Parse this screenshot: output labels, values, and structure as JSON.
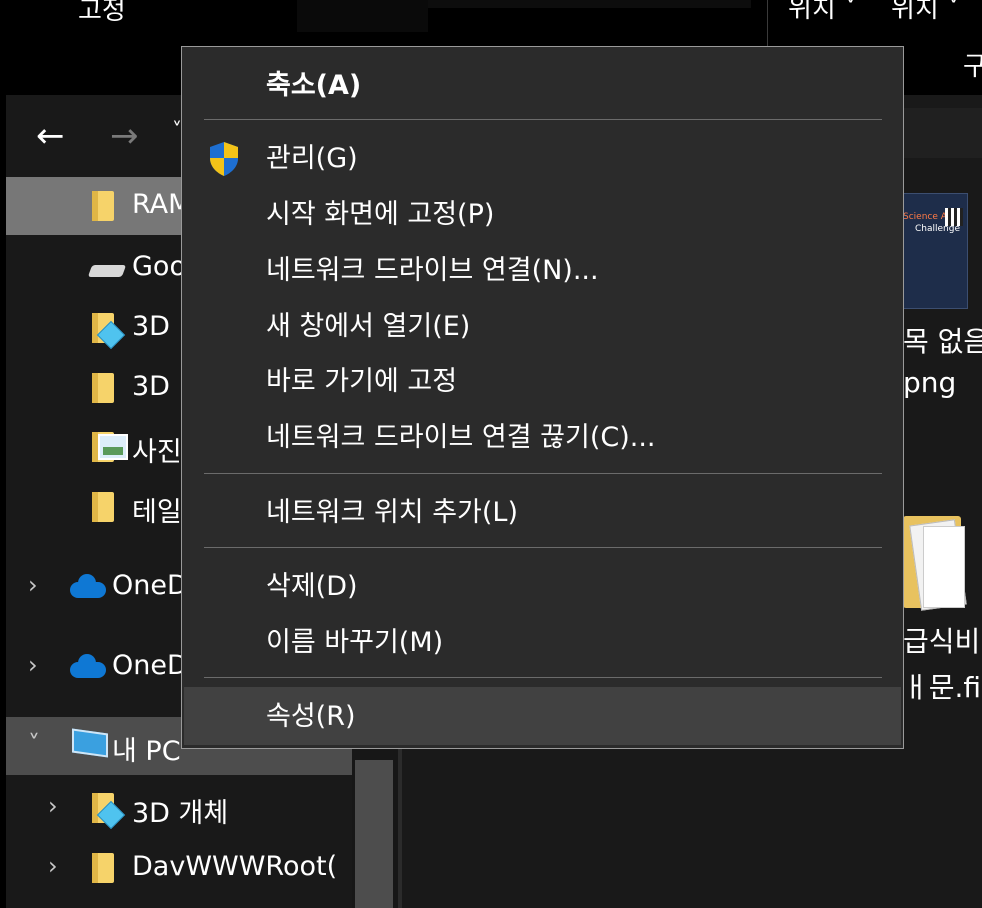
{
  "ribbon": {
    "pin_label": "고정",
    "location_1": "위치 ˅",
    "location_2": "위치 ˅",
    "group_label": "구"
  },
  "navbar": {
    "back": "←",
    "forward": "→",
    "dropdown": "˅"
  },
  "navpane": {
    "items": [
      {
        "label": "RAM",
        "icon": "folder-icon"
      },
      {
        "label": "Goo",
        "icon": "drive-icon"
      },
      {
        "label": "3D",
        "icon": "folder-3d-icon"
      },
      {
        "label": "3D",
        "icon": "folder-icon"
      },
      {
        "label": "사진",
        "icon": "pictures-icon"
      },
      {
        "label": "테일",
        "icon": "folder-icon"
      },
      {
        "label": "OneD",
        "icon": "onedrive-icon"
      },
      {
        "label": "OneD",
        "icon": "onedrive-icon"
      },
      {
        "label": "내 PC",
        "icon": "pc-icon"
      },
      {
        "label": "3D 개체",
        "icon": "folder-3d-icon"
      },
      {
        "label": "DavWWWRoot(",
        "icon": "folder-icon"
      }
    ],
    "chevron_right": "›",
    "chevron_down": "˅"
  },
  "content": {
    "file1_line1": "목 없음",
    "file1_line2": "png",
    "file2_line1": "급식비",
    "file2_line2": "ㅐ문.file",
    "thumb_text_1": "Science App",
    "thumb_text_2": "Challenge"
  },
  "menu": {
    "collapse": "축소(A)",
    "manage": "관리(G)",
    "pin_start": "시작 화면에 고정(P)",
    "map_drive": "네트워크 드라이브 연결(N)...",
    "open_new_window": "새 창에서 열기(E)",
    "pin_quick": "바로 가기에 고정",
    "disconnect_drive": "네트워크 드라이브 연결 끊기(C)...",
    "add_network_location": "네트워크 위치 추가(L)",
    "delete": "삭제(D)",
    "rename": "이름 바꾸기(M)",
    "properties": "속성(R)"
  },
  "colors": {
    "menu_bg": "#2b2b2b",
    "menu_hover": "#414141",
    "nav_selected": "#777777",
    "folder": "#f6d36a",
    "onedrive": "#0f78d4"
  }
}
